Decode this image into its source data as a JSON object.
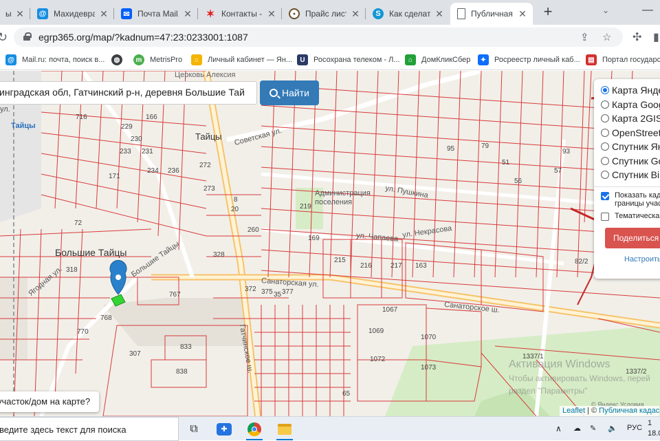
{
  "browser": {
    "tabs": [
      {
        "title": "ы...",
        "favicon": "generic-icon",
        "color": "#888888"
      },
      {
        "title": "Махидевран",
        "favicon": "mailru-icon",
        "color": "#168de2"
      },
      {
        "title": "Почта Mail.r",
        "favicon": "envelope-icon",
        "color": "#005ff9"
      },
      {
        "title": "Контакты - ",
        "favicon": "star-logo-icon",
        "color": "#e02020"
      },
      {
        "title": "Прайс лист",
        "favicon": "badge-icon",
        "color": "#6b4f2a"
      },
      {
        "title": "Как сделать",
        "favicon": "skype-icon",
        "color": "#1296d6"
      },
      {
        "title": "Публичная ",
        "favicon": "document-icon",
        "color": "#5f6368"
      }
    ],
    "url": "egrp365.org/map/?kadnum=47:23:0233001:1087",
    "bookmarks": [
      {
        "label": "Mail.ru: почта, поиск в...",
        "icon": "mailru-icon",
        "color": "#168de2"
      },
      {
        "label": "",
        "icon": "globe-icon",
        "color": "#3c4043"
      },
      {
        "label": "MetrisPro",
        "icon": "metris-icon",
        "color": "#4caf50"
      },
      {
        "label": "Личный кабинет — Ян...",
        "icon": "house-icon",
        "color": "#f4b400"
      },
      {
        "label": "Росохрана телеком - Л...",
        "icon": "shield-icon",
        "color": "#2b3a67"
      },
      {
        "label": "ДомКликСбер",
        "icon": "domclick-icon",
        "color": "#21a038"
      },
      {
        "label": "Росреестр личный каб...",
        "icon": "rosreestr-icon",
        "color": "#0d6efd"
      },
      {
        "label": "Портал государств",
        "icon": "gosuslugi-icon",
        "color": "#d32f2f"
      }
    ]
  },
  "map": {
    "search_value": "инградская обл, Гатчинский р-н, деревня Большие Тай",
    "search_button": "Найти",
    "layers": [
      {
        "label": "Карта Янде",
        "selected": true
      },
      {
        "label": "Карта Goog",
        "selected": false
      },
      {
        "label": "Карта 2GIS",
        "selected": false
      },
      {
        "label": "OpenStreet",
        "selected": false
      },
      {
        "label": "Спутник Ян",
        "selected": false
      },
      {
        "label": "Спутник Go",
        "selected": false
      },
      {
        "label": "Спутник Bi",
        "selected": false
      }
    ],
    "show_cadastral": {
      "label_line1": "Показать кад",
      "label_line2": "границы учас",
      "checked": true
    },
    "thematic": {
      "label": "Тематическа",
      "checked": false
    },
    "share_button": "Поделиться",
    "configure_link": "Настроить",
    "plot_prompt": "участок/дом на карте?",
    "attribution_leaflet": "Leaflet",
    "attribution_sep": " | © ",
    "attribution_pkk": "Публичная кадас",
    "yandex_terms": "© Яндекс  Условия",
    "labels": {
      "church": "Церковь Алексия",
      "taitsy_station": "Тайцы",
      "taitsy": "Тайцы",
      "bolshie_taitsy": "Большие Тайцы",
      "admin": "Администрация",
      "admin2": "поселения",
      "sovetskaya": "Советская ул.",
      "pionerskaya": "ул. Пушкина",
      "sanatorskaya": "Санаторская ул.",
      "sanatornoe": "Санаторское ш.",
      "gatchinskoe": "Гатчинское ш.",
      "chapaeva": "ул. Чапаева",
      "nekrasova": "ул. Некрасова",
      "yagodnaya": "Ягодная ул.",
      "bolshie_taitsy_street": "Большие Тайцы",
      "ul": "ул."
    },
    "parcels": [
      "716",
      "229",
      "166",
      "230",
      "233",
      "231",
      "171",
      "234",
      "272",
      "236",
      "273",
      "72",
      "219",
      "260",
      "169",
      "215",
      "216",
      "217",
      "163",
      "318",
      "328",
      "372",
      "375",
      "377",
      "35",
      "767",
      "768",
      "770",
      "1067",
      "1069",
      "1070",
      "1072",
      "1073",
      "307",
      "833",
      "838",
      "65",
      "1337/1",
      "1337/2",
      "82/2",
      "79",
      "95",
      "51",
      "56",
      "93",
      "57",
      "20",
      "8"
    ],
    "watermark_title": "Активация Windows",
    "watermark_line1": "Чтобы активировать Windows, перей",
    "watermark_line2": "раздел \"Параметры\""
  },
  "taskbar": {
    "search_placeholder": "ведите здесь текст для поиска",
    "apps": [
      {
        "name": "task-view-icon"
      },
      {
        "name": "game-controller-icon"
      },
      {
        "name": "chrome-icon"
      },
      {
        "name": "file-explorer-icon"
      }
    ],
    "lang": "РУС",
    "time": "1",
    "date": "18.0"
  },
  "colors": {
    "parcel_stroke": "#d83a3a",
    "road_major": "#f6c36a",
    "search_button": "#337ab7",
    "share_button": "#d9534f",
    "marker": "#2a81cb",
    "selected_plot": "#35d435"
  }
}
